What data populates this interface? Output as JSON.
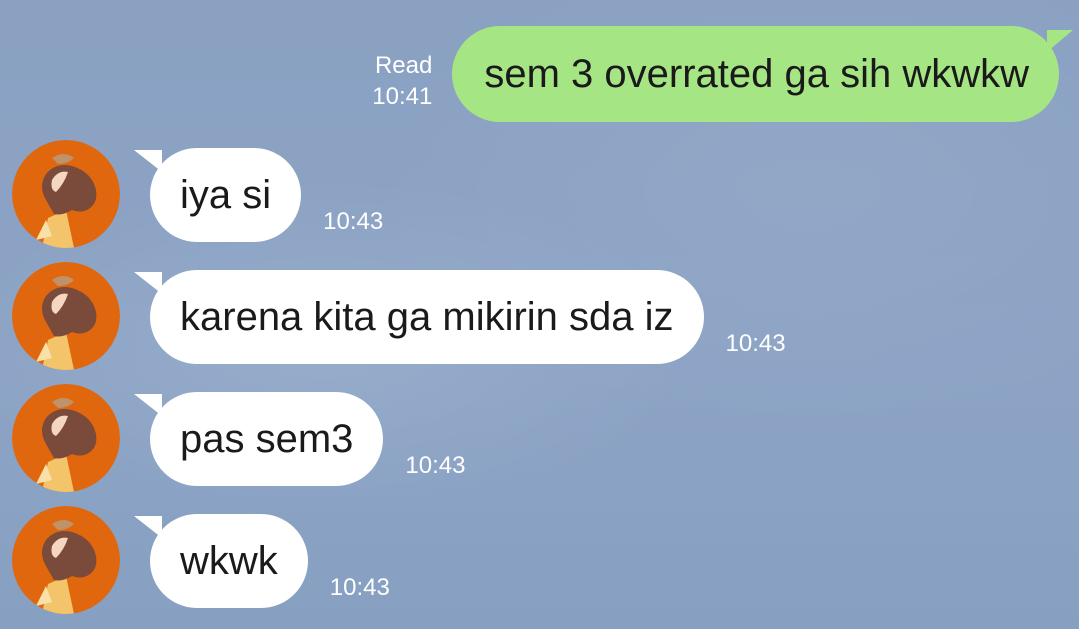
{
  "outgoing": {
    "read_label": "Read",
    "time": "10:41",
    "text": "sem 3 overrated ga sih wkwkw"
  },
  "incoming": [
    {
      "text": "iya si",
      "time": "10:43"
    },
    {
      "text": "karena kita ga mikirin sda iz",
      "time": "10:43"
    },
    {
      "text": "pas sem3",
      "time": "10:43"
    },
    {
      "text": "wkwk",
      "time": "10:43"
    }
  ],
  "colors": {
    "background": "#8aa2c4",
    "outgoing_bubble": "#a6e584",
    "incoming_bubble": "#ffffff",
    "avatar_bg": "#e0670e"
  }
}
